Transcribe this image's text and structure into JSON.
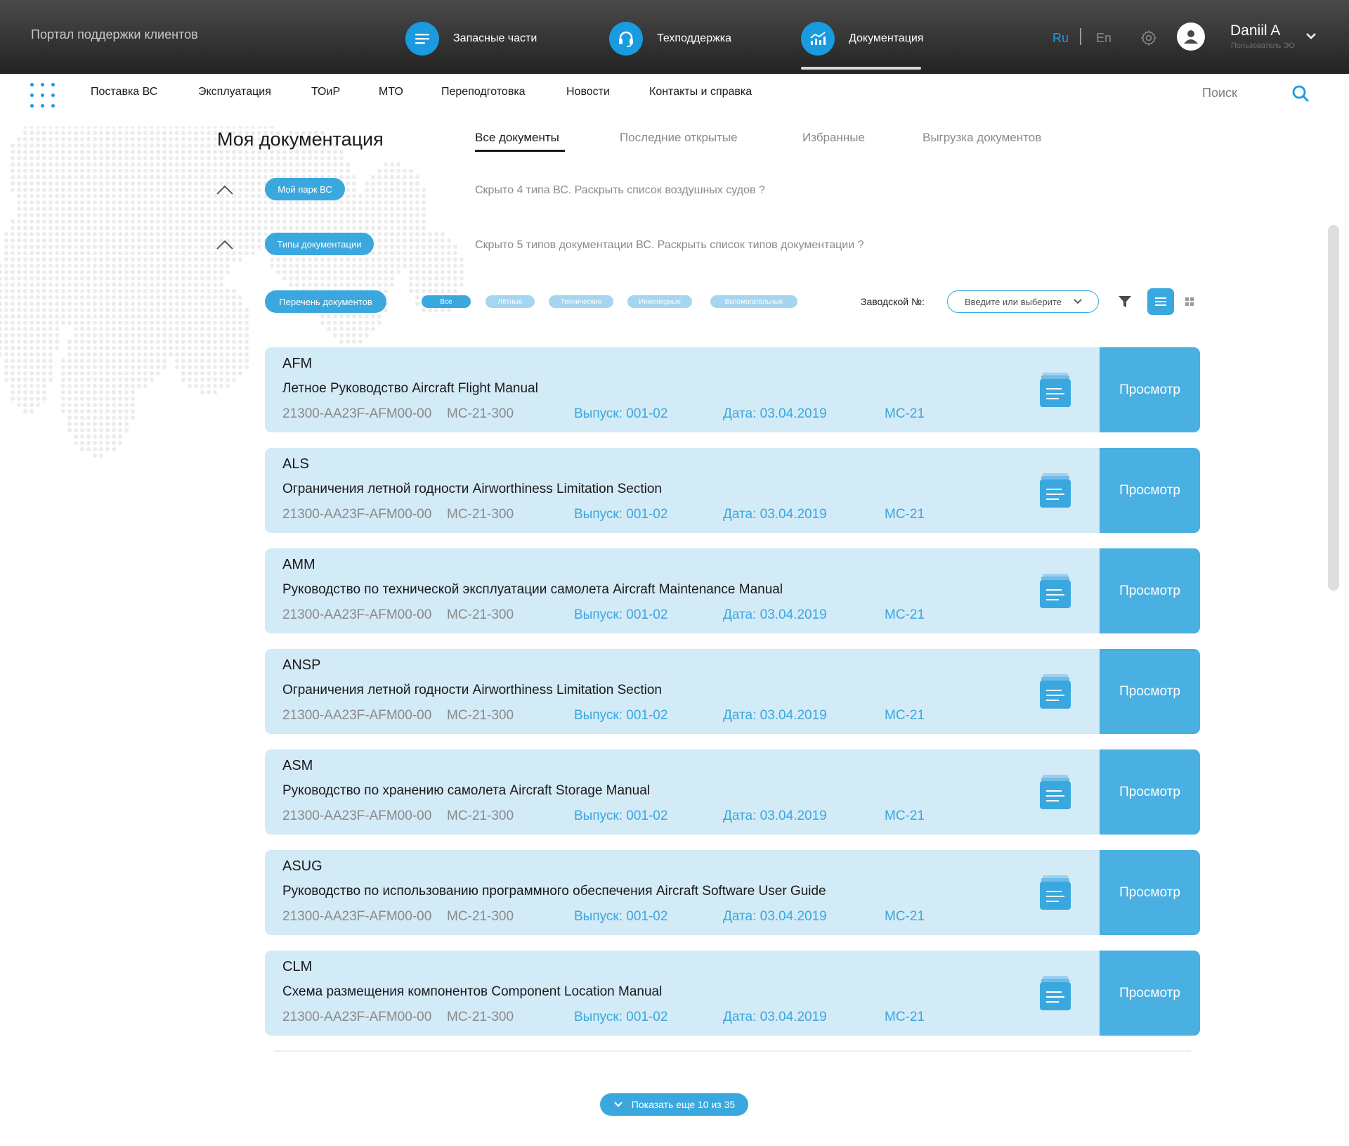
{
  "header": {
    "portal_title": "Портал поддержки клиентов",
    "nav": [
      {
        "label": "Запасные части",
        "icon": "list-icon"
      },
      {
        "label": "Техподдержка",
        "icon": "headset-icon"
      },
      {
        "label": "Документация",
        "icon": "chart-icon",
        "active": true
      }
    ],
    "lang_ru": "Ru",
    "lang_en": "En",
    "user_name": "Daniil A",
    "user_role": "Пользователь ЭО",
    "accent_color": "#1a9be0"
  },
  "subnav": {
    "items": [
      "Поставка ВС",
      "Эксплуатация",
      "ТОиР",
      "МТО",
      "Переподготовка",
      "Новости",
      "Контакты и справка"
    ],
    "search_label": "Поиск"
  },
  "page": {
    "title": "Моя документация",
    "tabs": [
      "Все документы",
      "Последние открытые",
      "Избранные",
      "Выгрузка документов"
    ],
    "active_tab": "Все документы"
  },
  "filters": {
    "fleet_pill": "Мой парк ВС",
    "fleet_hint": "Скрыто 4 типа ВС. Раскрыть список воздушных судов ?",
    "types_pill": "Типы документации",
    "types_hint": "Скрыто 5 типов документации ВС. Раскрыть список типов документации ?",
    "list_pill": "Перечень документов",
    "chips": [
      "Все",
      "Лётные",
      "Технические",
      "Инженерные",
      "Вспомогательные"
    ],
    "selected_chip": "Все",
    "serial_label": "Заводской №:",
    "serial_placeholder": "Введите или выберите"
  },
  "documents": [
    {
      "code": "AFM",
      "title": "Летное Руководство Aircraft Flight Manual",
      "doc_number": "21300-AA23F-AFM00-00",
      "model": "МС-21-300",
      "issue": "Выпуск: 001-02",
      "date": "Дата: 03.04.2019",
      "type": "МС-21",
      "action": "Просмотр"
    },
    {
      "code": "ALS",
      "title": "Ограничения летной годности Airworthiness Limitation Section",
      "doc_number": "21300-AA23F-AFM00-00",
      "model": "МС-21-300",
      "issue": "Выпуск: 001-02",
      "date": "Дата: 03.04.2019",
      "type": "МС-21",
      "action": "Просмотр"
    },
    {
      "code": "AMM",
      "title": "Руководство по технической эксплуатации самолета Aircraft Maintenance Manual",
      "doc_number": "21300-AA23F-AFM00-00",
      "model": "МС-21-300",
      "issue": "Выпуск: 001-02",
      "date": "Дата: 03.04.2019",
      "type": "МС-21",
      "action": "Просмотр"
    },
    {
      "code": "ANSP",
      "title": "Ограничения летной годности Airworthiness Limitation Section",
      "doc_number": "21300-AA23F-AFM00-00",
      "model": "МС-21-300",
      "issue": "Выпуск: 001-02",
      "date": "Дата: 03.04.2019",
      "type": "МС-21",
      "action": "Просмотр"
    },
    {
      "code": "ASM",
      "title": "Руководство по хранению самолета Aircraft Storage Manual",
      "doc_number": "21300-AA23F-AFM00-00",
      "model": "МС-21-300",
      "issue": "Выпуск: 001-02",
      "date": "Дата: 03.04.2019",
      "type": "МС-21",
      "action": "Просмотр"
    },
    {
      "code": "ASUG",
      "title": "Руководство по использованию программного обеспечения Aircraft Software User Guide",
      "doc_number": "21300-AA23F-AFM00-00",
      "model": "МС-21-300",
      "issue": "Выпуск: 001-02",
      "date": "Дата: 03.04.2019",
      "type": "МС-21",
      "action": "Просмотр"
    },
    {
      "code": "CLM",
      "title": "Схема размещения компонентов Component Location Manual",
      "doc_number": "21300-AA23F-AFM00-00",
      "model": "МС-21-300",
      "issue": "Выпуск: 001-02",
      "date": "Дата: 03.04.2019",
      "type": "МС-21",
      "action": "Просмотр"
    }
  ],
  "show_more": "Показать еще 10 из 35"
}
